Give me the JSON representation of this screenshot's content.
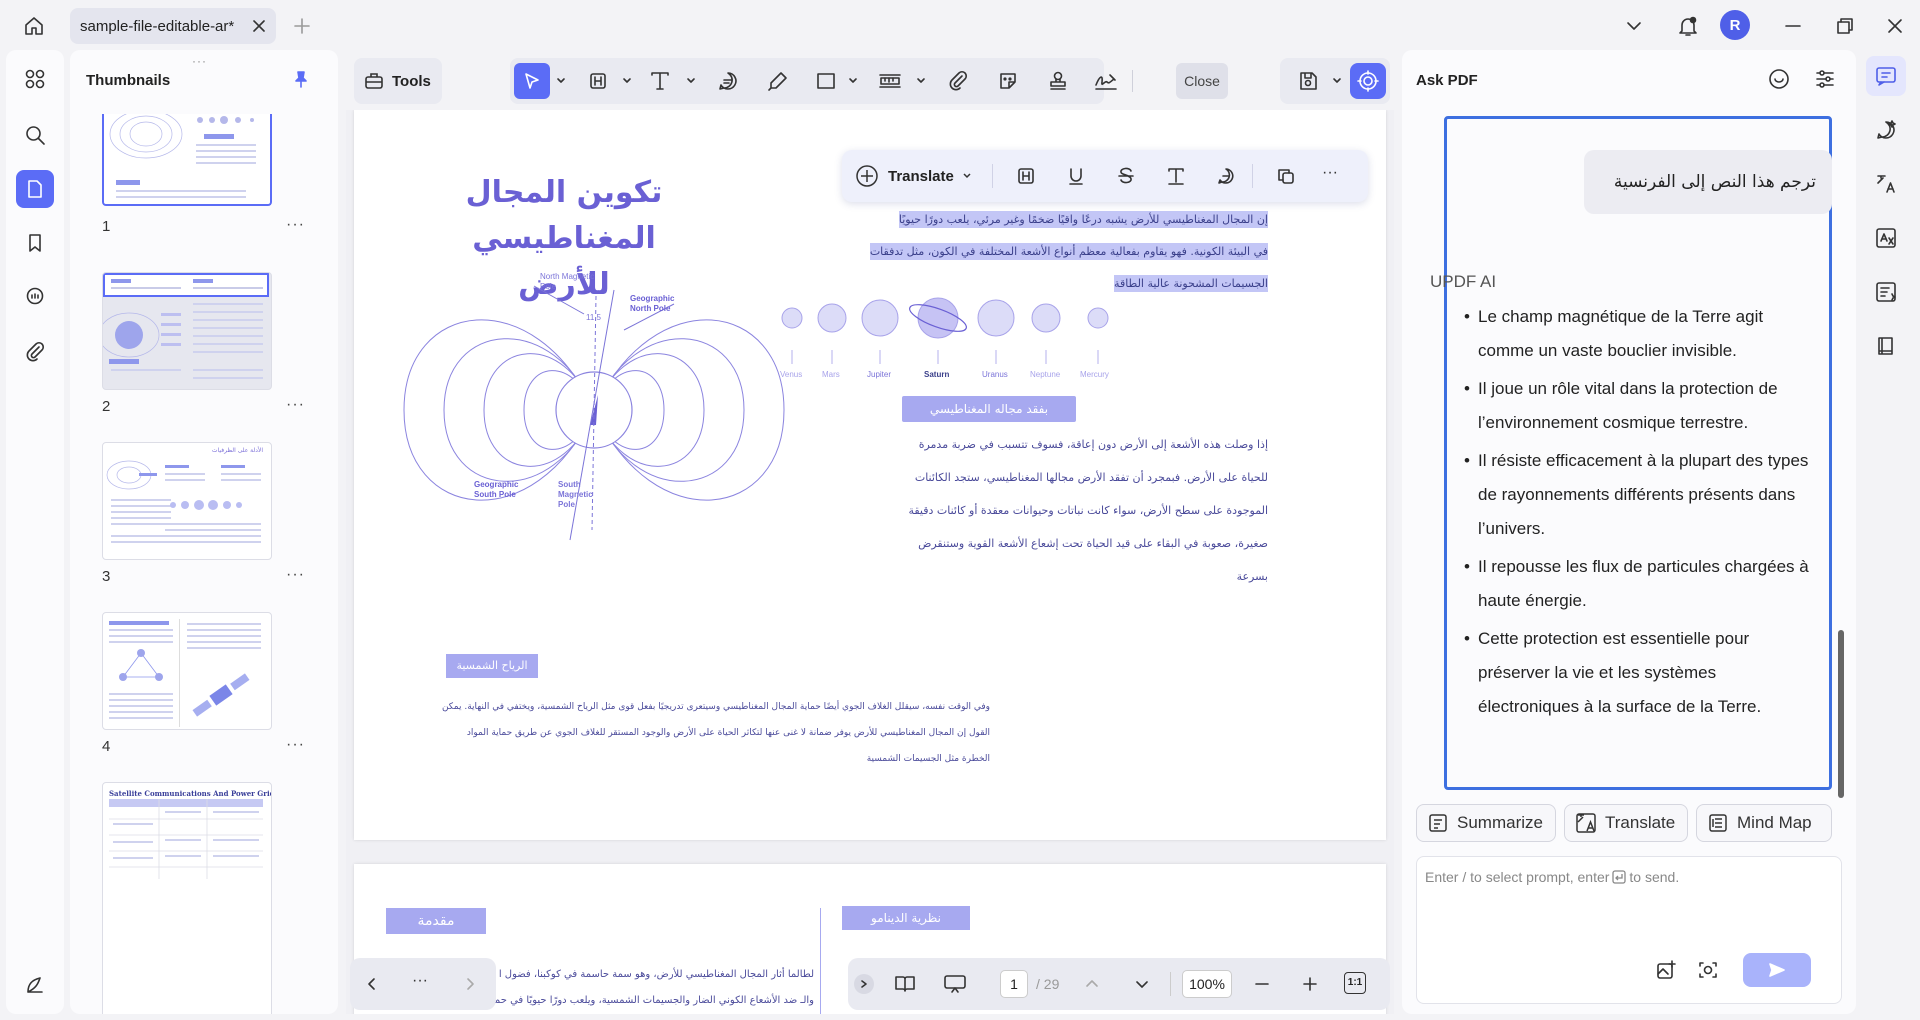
{
  "window": {
    "tab_title": "sample-file-editable-ar*",
    "user_initial": "R"
  },
  "thumbnails": {
    "title": "Thumbnails",
    "pages": [
      {
        "number": "1",
        "more": "···"
      },
      {
        "number": "2",
        "more": "···"
      },
      {
        "number": "3",
        "more": "···"
      },
      {
        "number": "4",
        "more": "···"
      }
    ],
    "page5_title": "Satellite Communications And Power Grids",
    "page3_heading": "الأدلة على الظرفيات"
  },
  "toolbar": {
    "tools_label": "Tools",
    "close_label": "Close"
  },
  "float_toolbar": {
    "translate_label": "Translate",
    "more": "···"
  },
  "document": {
    "page1": {
      "title_line1": "تكوين المجال",
      "title_line2": "المغناطيسي للأرض",
      "highlight_lines": [
        "إن المجال المغناطيسي للأرض يشبه درعًا واقيًا ضخمًا وغير مرئي، يلعب دورًا حيويًا",
        "في البيئة الكونية. فهو يقاوم بفعالية معظم أنواع الأشعة المختلفة في الكون، مثل تدفقات",
        "الجسيمات المشحونة عالية الطاقة"
      ],
      "diagram_labels": {
        "north_magnetic": "North Magnetic Pole",
        "geo_north": "Geographic North Pole",
        "angle": "11.5",
        "geo_south": "Geographic South Pole",
        "south_magnetic": "South Magnetic Pole"
      },
      "planets": [
        "Venus",
        "Mars",
        "Jupiter",
        "Saturn",
        "Uranus",
        "Neptune",
        "Mercury"
      ],
      "section_tag": "بفقد مجاله المغناطيسي",
      "section_lines": [
        "إذا وصلت هذه الأشعة إلى الأرض دون إعاقة، فسوف تتسبب في ضربة مدمرة",
        "للحياة على الأرض. فبمجرد أن تفقد الأرض مجالها المغناطيسي، ستجد الكائنات",
        "الموجودة على سطح الأرض، سواء كانت نباتات وحيوانات معقدة أو كائنات دقيقة",
        "صغيرة، صعوبة في البقاء على قيد الحياة تحت إشعاع الأشعة القوية وستنقرض",
        "بسرعة"
      ],
      "wind_tag": "الرياح الشمسية",
      "wind_lines": [
        "وفي الوقت نفسه، سيقلل الغلاف الجوي أيضًا حماية المجال المغناطيسي وسيتعرى تدريجيًا بفعل قوى مثل الرياح الشمسية، ويختفي في النهاية. يمكن",
        "القول إن المجال المغناطيسي للأرض يوفر ضمانة لا غنى عنها لتكاثر الحياة على الأرض والوجود المستقر للغلاف الجوي عن طريق حماية المواد",
        "الخطرة مثل الجسيمات الشمسية"
      ]
    },
    "page2": {
      "intro_tag": "مقدمة",
      "dynamo_tag": "نظرية الدينامو",
      "line1": "لطالما أثار المجال المغناطيسي للأرض، وهو سمة حاسمة في كوكبنا، فضول ا",
      "line2": "والـ ضد الأشعاع الكوني الضار والجسيمات الشمسية، ويلعب دورًا حيويًا في حماية الحياة على الأرض"
    }
  },
  "bottom_nav": {
    "more": "···",
    "page_current": "1",
    "page_total": "/ 29",
    "zoom": "100%",
    "fit_label": "1:1"
  },
  "ask_pdf": {
    "title": "Ask PDF",
    "user_prompt": "ترجم هذا النص إلى الفرنسية",
    "ai_label": "UPDF AI",
    "answer": [
      "Le champ magnétique de la Terre agit comme un vaste bouclier invisible.",
      "Il joue un rôle vital dans la protection de l’environnement cosmique terrestre.",
      "Il résiste efficacement à la plupart des types de rayonnements différents présents dans l’univers.",
      "Il repousse les flux de particules chargées à haute énergie.",
      "Cette protection est essentielle pour préserver la vie et les systèmes électroniques à la surface de la Terre."
    ],
    "actions": {
      "summarize": "Summarize",
      "translate": "Translate",
      "mind_map": "Mind Map"
    },
    "input_placeholder_a": "Enter / to select prompt, enter",
    "input_placeholder_b": "to send."
  },
  "colors": {
    "accent": "#5b6cf6",
    "purple": "#7b6fd8",
    "highlight": "#c3c6f6",
    "selection_border": "#3d6fe0"
  }
}
